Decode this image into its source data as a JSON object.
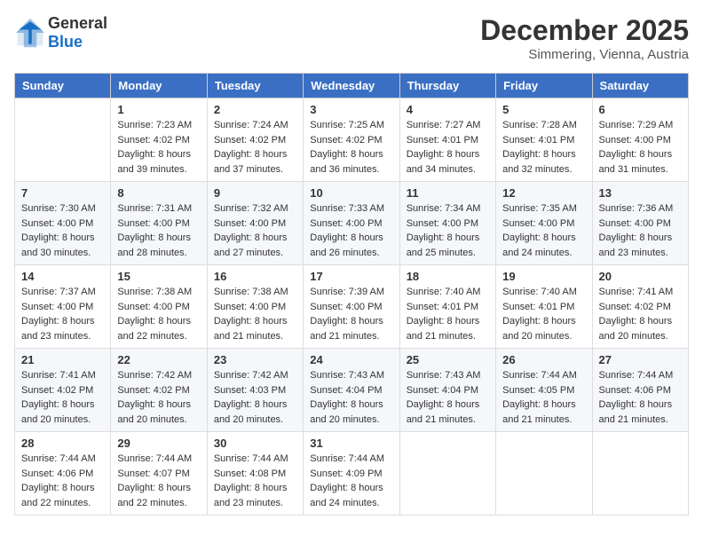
{
  "header": {
    "logo_general": "General",
    "logo_blue": "Blue",
    "month_title": "December 2025",
    "location": "Simmering, Vienna, Austria"
  },
  "weekdays": [
    "Sunday",
    "Monday",
    "Tuesday",
    "Wednesday",
    "Thursday",
    "Friday",
    "Saturday"
  ],
  "weeks": [
    [
      {
        "day": "",
        "sunrise": "",
        "sunset": "",
        "daylight": ""
      },
      {
        "day": "1",
        "sunrise": "Sunrise: 7:23 AM",
        "sunset": "Sunset: 4:02 PM",
        "daylight": "Daylight: 8 hours and 39 minutes."
      },
      {
        "day": "2",
        "sunrise": "Sunrise: 7:24 AM",
        "sunset": "Sunset: 4:02 PM",
        "daylight": "Daylight: 8 hours and 37 minutes."
      },
      {
        "day": "3",
        "sunrise": "Sunrise: 7:25 AM",
        "sunset": "Sunset: 4:02 PM",
        "daylight": "Daylight: 8 hours and 36 minutes."
      },
      {
        "day": "4",
        "sunrise": "Sunrise: 7:27 AM",
        "sunset": "Sunset: 4:01 PM",
        "daylight": "Daylight: 8 hours and 34 minutes."
      },
      {
        "day": "5",
        "sunrise": "Sunrise: 7:28 AM",
        "sunset": "Sunset: 4:01 PM",
        "daylight": "Daylight: 8 hours and 32 minutes."
      },
      {
        "day": "6",
        "sunrise": "Sunrise: 7:29 AM",
        "sunset": "Sunset: 4:00 PM",
        "daylight": "Daylight: 8 hours and 31 minutes."
      }
    ],
    [
      {
        "day": "7",
        "sunrise": "Sunrise: 7:30 AM",
        "sunset": "Sunset: 4:00 PM",
        "daylight": "Daylight: 8 hours and 30 minutes."
      },
      {
        "day": "8",
        "sunrise": "Sunrise: 7:31 AM",
        "sunset": "Sunset: 4:00 PM",
        "daylight": "Daylight: 8 hours and 28 minutes."
      },
      {
        "day": "9",
        "sunrise": "Sunrise: 7:32 AM",
        "sunset": "Sunset: 4:00 PM",
        "daylight": "Daylight: 8 hours and 27 minutes."
      },
      {
        "day": "10",
        "sunrise": "Sunrise: 7:33 AM",
        "sunset": "Sunset: 4:00 PM",
        "daylight": "Daylight: 8 hours and 26 minutes."
      },
      {
        "day": "11",
        "sunrise": "Sunrise: 7:34 AM",
        "sunset": "Sunset: 4:00 PM",
        "daylight": "Daylight: 8 hours and 25 minutes."
      },
      {
        "day": "12",
        "sunrise": "Sunrise: 7:35 AM",
        "sunset": "Sunset: 4:00 PM",
        "daylight": "Daylight: 8 hours and 24 minutes."
      },
      {
        "day": "13",
        "sunrise": "Sunrise: 7:36 AM",
        "sunset": "Sunset: 4:00 PM",
        "daylight": "Daylight: 8 hours and 23 minutes."
      }
    ],
    [
      {
        "day": "14",
        "sunrise": "Sunrise: 7:37 AM",
        "sunset": "Sunset: 4:00 PM",
        "daylight": "Daylight: 8 hours and 23 minutes."
      },
      {
        "day": "15",
        "sunrise": "Sunrise: 7:38 AM",
        "sunset": "Sunset: 4:00 PM",
        "daylight": "Daylight: 8 hours and 22 minutes."
      },
      {
        "day": "16",
        "sunrise": "Sunrise: 7:38 AM",
        "sunset": "Sunset: 4:00 PM",
        "daylight": "Daylight: 8 hours and 21 minutes."
      },
      {
        "day": "17",
        "sunrise": "Sunrise: 7:39 AM",
        "sunset": "Sunset: 4:00 PM",
        "daylight": "Daylight: 8 hours and 21 minutes."
      },
      {
        "day": "18",
        "sunrise": "Sunrise: 7:40 AM",
        "sunset": "Sunset: 4:01 PM",
        "daylight": "Daylight: 8 hours and 21 minutes."
      },
      {
        "day": "19",
        "sunrise": "Sunrise: 7:40 AM",
        "sunset": "Sunset: 4:01 PM",
        "daylight": "Daylight: 8 hours and 20 minutes."
      },
      {
        "day": "20",
        "sunrise": "Sunrise: 7:41 AM",
        "sunset": "Sunset: 4:02 PM",
        "daylight": "Daylight: 8 hours and 20 minutes."
      }
    ],
    [
      {
        "day": "21",
        "sunrise": "Sunrise: 7:41 AM",
        "sunset": "Sunset: 4:02 PM",
        "daylight": "Daylight: 8 hours and 20 minutes."
      },
      {
        "day": "22",
        "sunrise": "Sunrise: 7:42 AM",
        "sunset": "Sunset: 4:02 PM",
        "daylight": "Daylight: 8 hours and 20 minutes."
      },
      {
        "day": "23",
        "sunrise": "Sunrise: 7:42 AM",
        "sunset": "Sunset: 4:03 PM",
        "daylight": "Daylight: 8 hours and 20 minutes."
      },
      {
        "day": "24",
        "sunrise": "Sunrise: 7:43 AM",
        "sunset": "Sunset: 4:04 PM",
        "daylight": "Daylight: 8 hours and 20 minutes."
      },
      {
        "day": "25",
        "sunrise": "Sunrise: 7:43 AM",
        "sunset": "Sunset: 4:04 PM",
        "daylight": "Daylight: 8 hours and 21 minutes."
      },
      {
        "day": "26",
        "sunrise": "Sunrise: 7:44 AM",
        "sunset": "Sunset: 4:05 PM",
        "daylight": "Daylight: 8 hours and 21 minutes."
      },
      {
        "day": "27",
        "sunrise": "Sunrise: 7:44 AM",
        "sunset": "Sunset: 4:06 PM",
        "daylight": "Daylight: 8 hours and 21 minutes."
      }
    ],
    [
      {
        "day": "28",
        "sunrise": "Sunrise: 7:44 AM",
        "sunset": "Sunset: 4:06 PM",
        "daylight": "Daylight: 8 hours and 22 minutes."
      },
      {
        "day": "29",
        "sunrise": "Sunrise: 7:44 AM",
        "sunset": "Sunset: 4:07 PM",
        "daylight": "Daylight: 8 hours and 22 minutes."
      },
      {
        "day": "30",
        "sunrise": "Sunrise: 7:44 AM",
        "sunset": "Sunset: 4:08 PM",
        "daylight": "Daylight: 8 hours and 23 minutes."
      },
      {
        "day": "31",
        "sunrise": "Sunrise: 7:44 AM",
        "sunset": "Sunset: 4:09 PM",
        "daylight": "Daylight: 8 hours and 24 minutes."
      },
      {
        "day": "",
        "sunrise": "",
        "sunset": "",
        "daylight": ""
      },
      {
        "day": "",
        "sunrise": "",
        "sunset": "",
        "daylight": ""
      },
      {
        "day": "",
        "sunrise": "",
        "sunset": "",
        "daylight": ""
      }
    ]
  ]
}
